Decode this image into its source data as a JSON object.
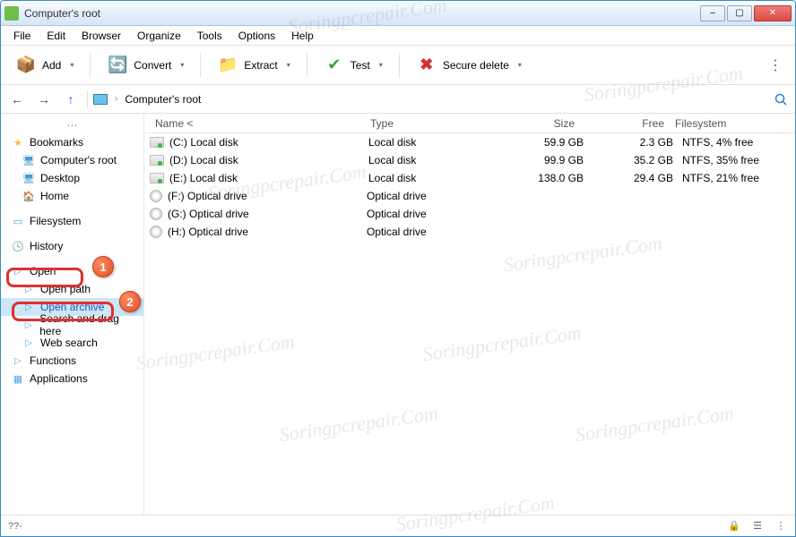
{
  "window": {
    "title": "Computer's root"
  },
  "menu": {
    "file": "File",
    "edit": "Edit",
    "browser": "Browser",
    "organize": "Organize",
    "tools": "Tools",
    "options": "Options",
    "help": "Help"
  },
  "toolbar": {
    "add": "Add",
    "convert": "Convert",
    "extract": "Extract",
    "test": "Test",
    "securedelete": "Secure delete"
  },
  "breadcrumb": {
    "root": "Computer's root"
  },
  "sidebar": {
    "bookmarks": "Bookmarks",
    "computers_root": "Computer's root",
    "desktop": "Desktop",
    "home": "Home",
    "filesystem": "Filesystem",
    "history": "History",
    "open": "Open",
    "open_path": "Open path",
    "open_archive": "Open archive",
    "search_drag": "Search and drag here",
    "web_search": "Web search",
    "functions": "Functions",
    "applications": "Applications"
  },
  "columns": {
    "name": "Name <",
    "type": "Type",
    "size": "Size",
    "free": "Free",
    "fs": "Filesystem"
  },
  "files": [
    {
      "name": "(C:) Local disk",
      "type": "Local disk",
      "size": "59.9 GB",
      "free": "2.3 GB",
      "fs": "NTFS, 4% free",
      "kind": "disk"
    },
    {
      "name": "(D:) Local disk",
      "type": "Local disk",
      "size": "99.9 GB",
      "free": "35.2 GB",
      "fs": "NTFS, 35% free",
      "kind": "disk"
    },
    {
      "name": "(E:) Local disk",
      "type": "Local disk",
      "size": "138.0 GB",
      "free": "29.4 GB",
      "fs": "NTFS, 21% free",
      "kind": "disk"
    },
    {
      "name": "(F:) Optical drive",
      "type": "Optical drive",
      "size": "",
      "free": "",
      "fs": "",
      "kind": "optical"
    },
    {
      "name": "(G:) Optical drive",
      "type": "Optical drive",
      "size": "",
      "free": "",
      "fs": "",
      "kind": "optical"
    },
    {
      "name": "(H:) Optical drive",
      "type": "Optical drive",
      "size": "",
      "free": "",
      "fs": "",
      "kind": "optical"
    }
  ],
  "statusbar": {
    "left": "??-"
  },
  "annotations": {
    "step1": "1",
    "step2": "2"
  },
  "watermark": "Soringpcrepair.Com"
}
